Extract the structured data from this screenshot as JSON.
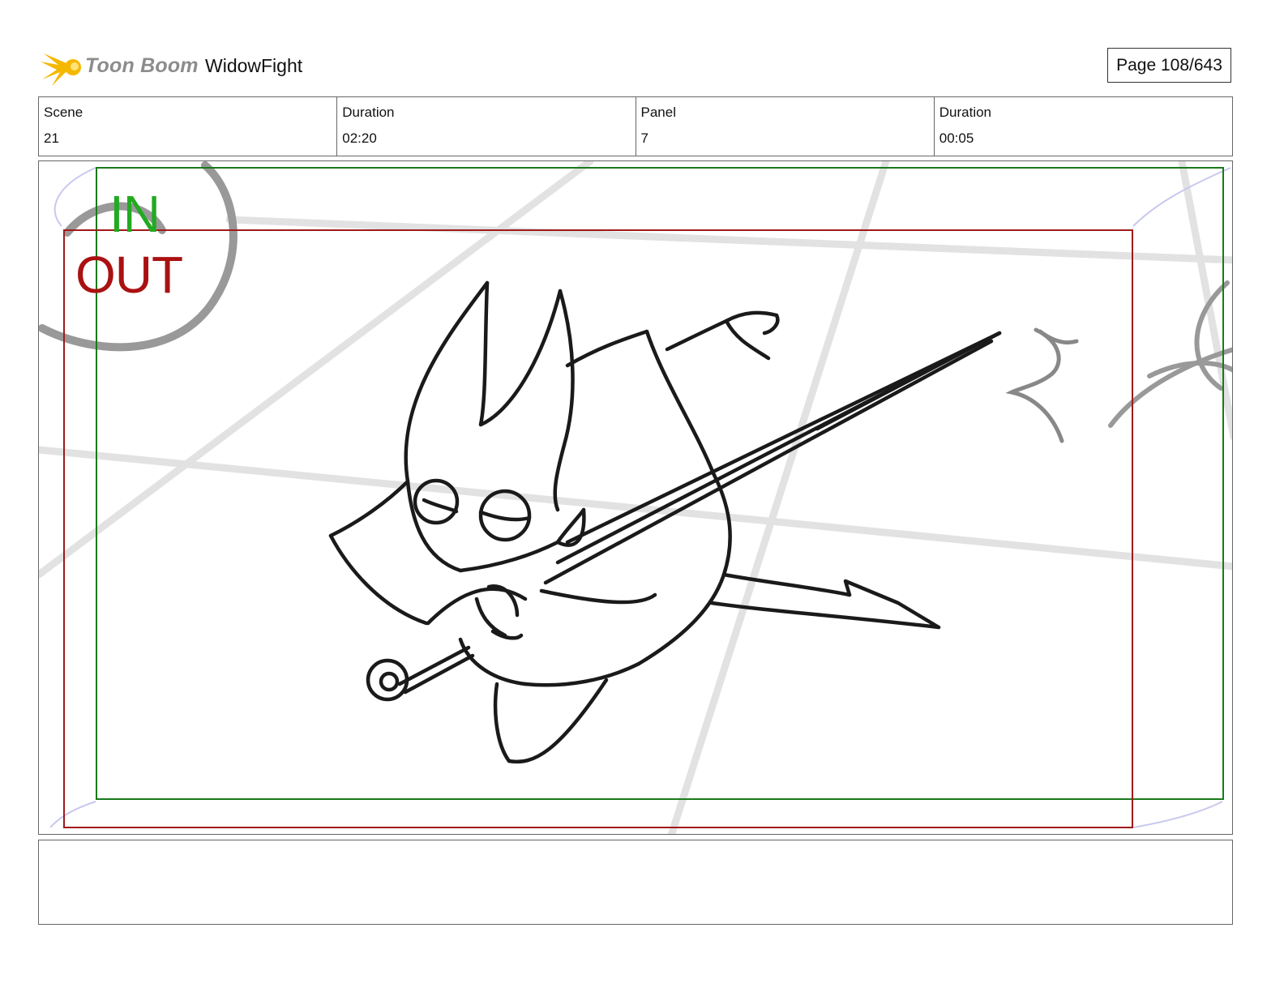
{
  "header": {
    "brand": "Toon Boom",
    "project_title": "WidowFight",
    "page_label": "Page 108/643"
  },
  "info": {
    "scene_label": "Scene",
    "scene_value": "21",
    "scene_duration_label": "Duration",
    "scene_duration_value": "02:20",
    "panel_label": "Panel",
    "panel_value": "7",
    "panel_duration_label": "Duration",
    "panel_duration_value": "00:05"
  },
  "panel": {
    "in_label": "IN",
    "out_label": "OUT",
    "in_color": "#22aa22",
    "out_color": "#aa1111"
  },
  "notes": {
    "text": ""
  }
}
